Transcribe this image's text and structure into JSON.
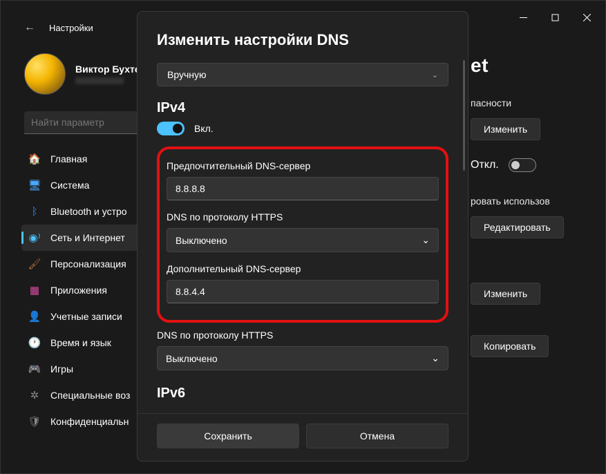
{
  "window": {
    "header_title": "Настройки"
  },
  "profile": {
    "name": "Виктор Бухте"
  },
  "search": {
    "placeholder": "Найти параметр"
  },
  "sidebar": {
    "items": [
      {
        "label": "Главная"
      },
      {
        "label": "Система"
      },
      {
        "label": "Bluetooth и устро"
      },
      {
        "label": "Сеть и Интернет"
      },
      {
        "label": "Персонализация"
      },
      {
        "label": "Приложения"
      },
      {
        "label": "Учетные записи"
      },
      {
        "label": "Время и язык"
      },
      {
        "label": "Игры"
      },
      {
        "label": "Специальные воз"
      },
      {
        "label": "Конфиденциальн"
      }
    ]
  },
  "right": {
    "title_suffix": "et",
    "security": "пасности",
    "btn_change": "Изменить",
    "off_label": "Откл.",
    "truncated1": "ровать использов",
    "btn_edit": "Редактировать",
    "btn_change2": "Изменить",
    "btn_copy": "Копировать"
  },
  "modal": {
    "title": "Изменить настройки DNS",
    "mode_select": "Вручную",
    "ipv4": {
      "heading": "IPv4",
      "toggle_label": "Вкл.",
      "preferred_label": "Предпочтительный DNS-сервер",
      "preferred_value": "8.8.8.8",
      "doh_label_1": "DNS по протоколу HTTPS",
      "doh_value_1": "Выключено",
      "alt_label": "Дополнительный DNS-сервер",
      "alt_value": "8.8.4.4",
      "doh_label_2": "DNS по протоколу HTTPS",
      "doh_value_2": "Выключено"
    },
    "ipv6": {
      "heading": "IPv6"
    },
    "save": "Сохранить",
    "cancel": "Отмена"
  }
}
